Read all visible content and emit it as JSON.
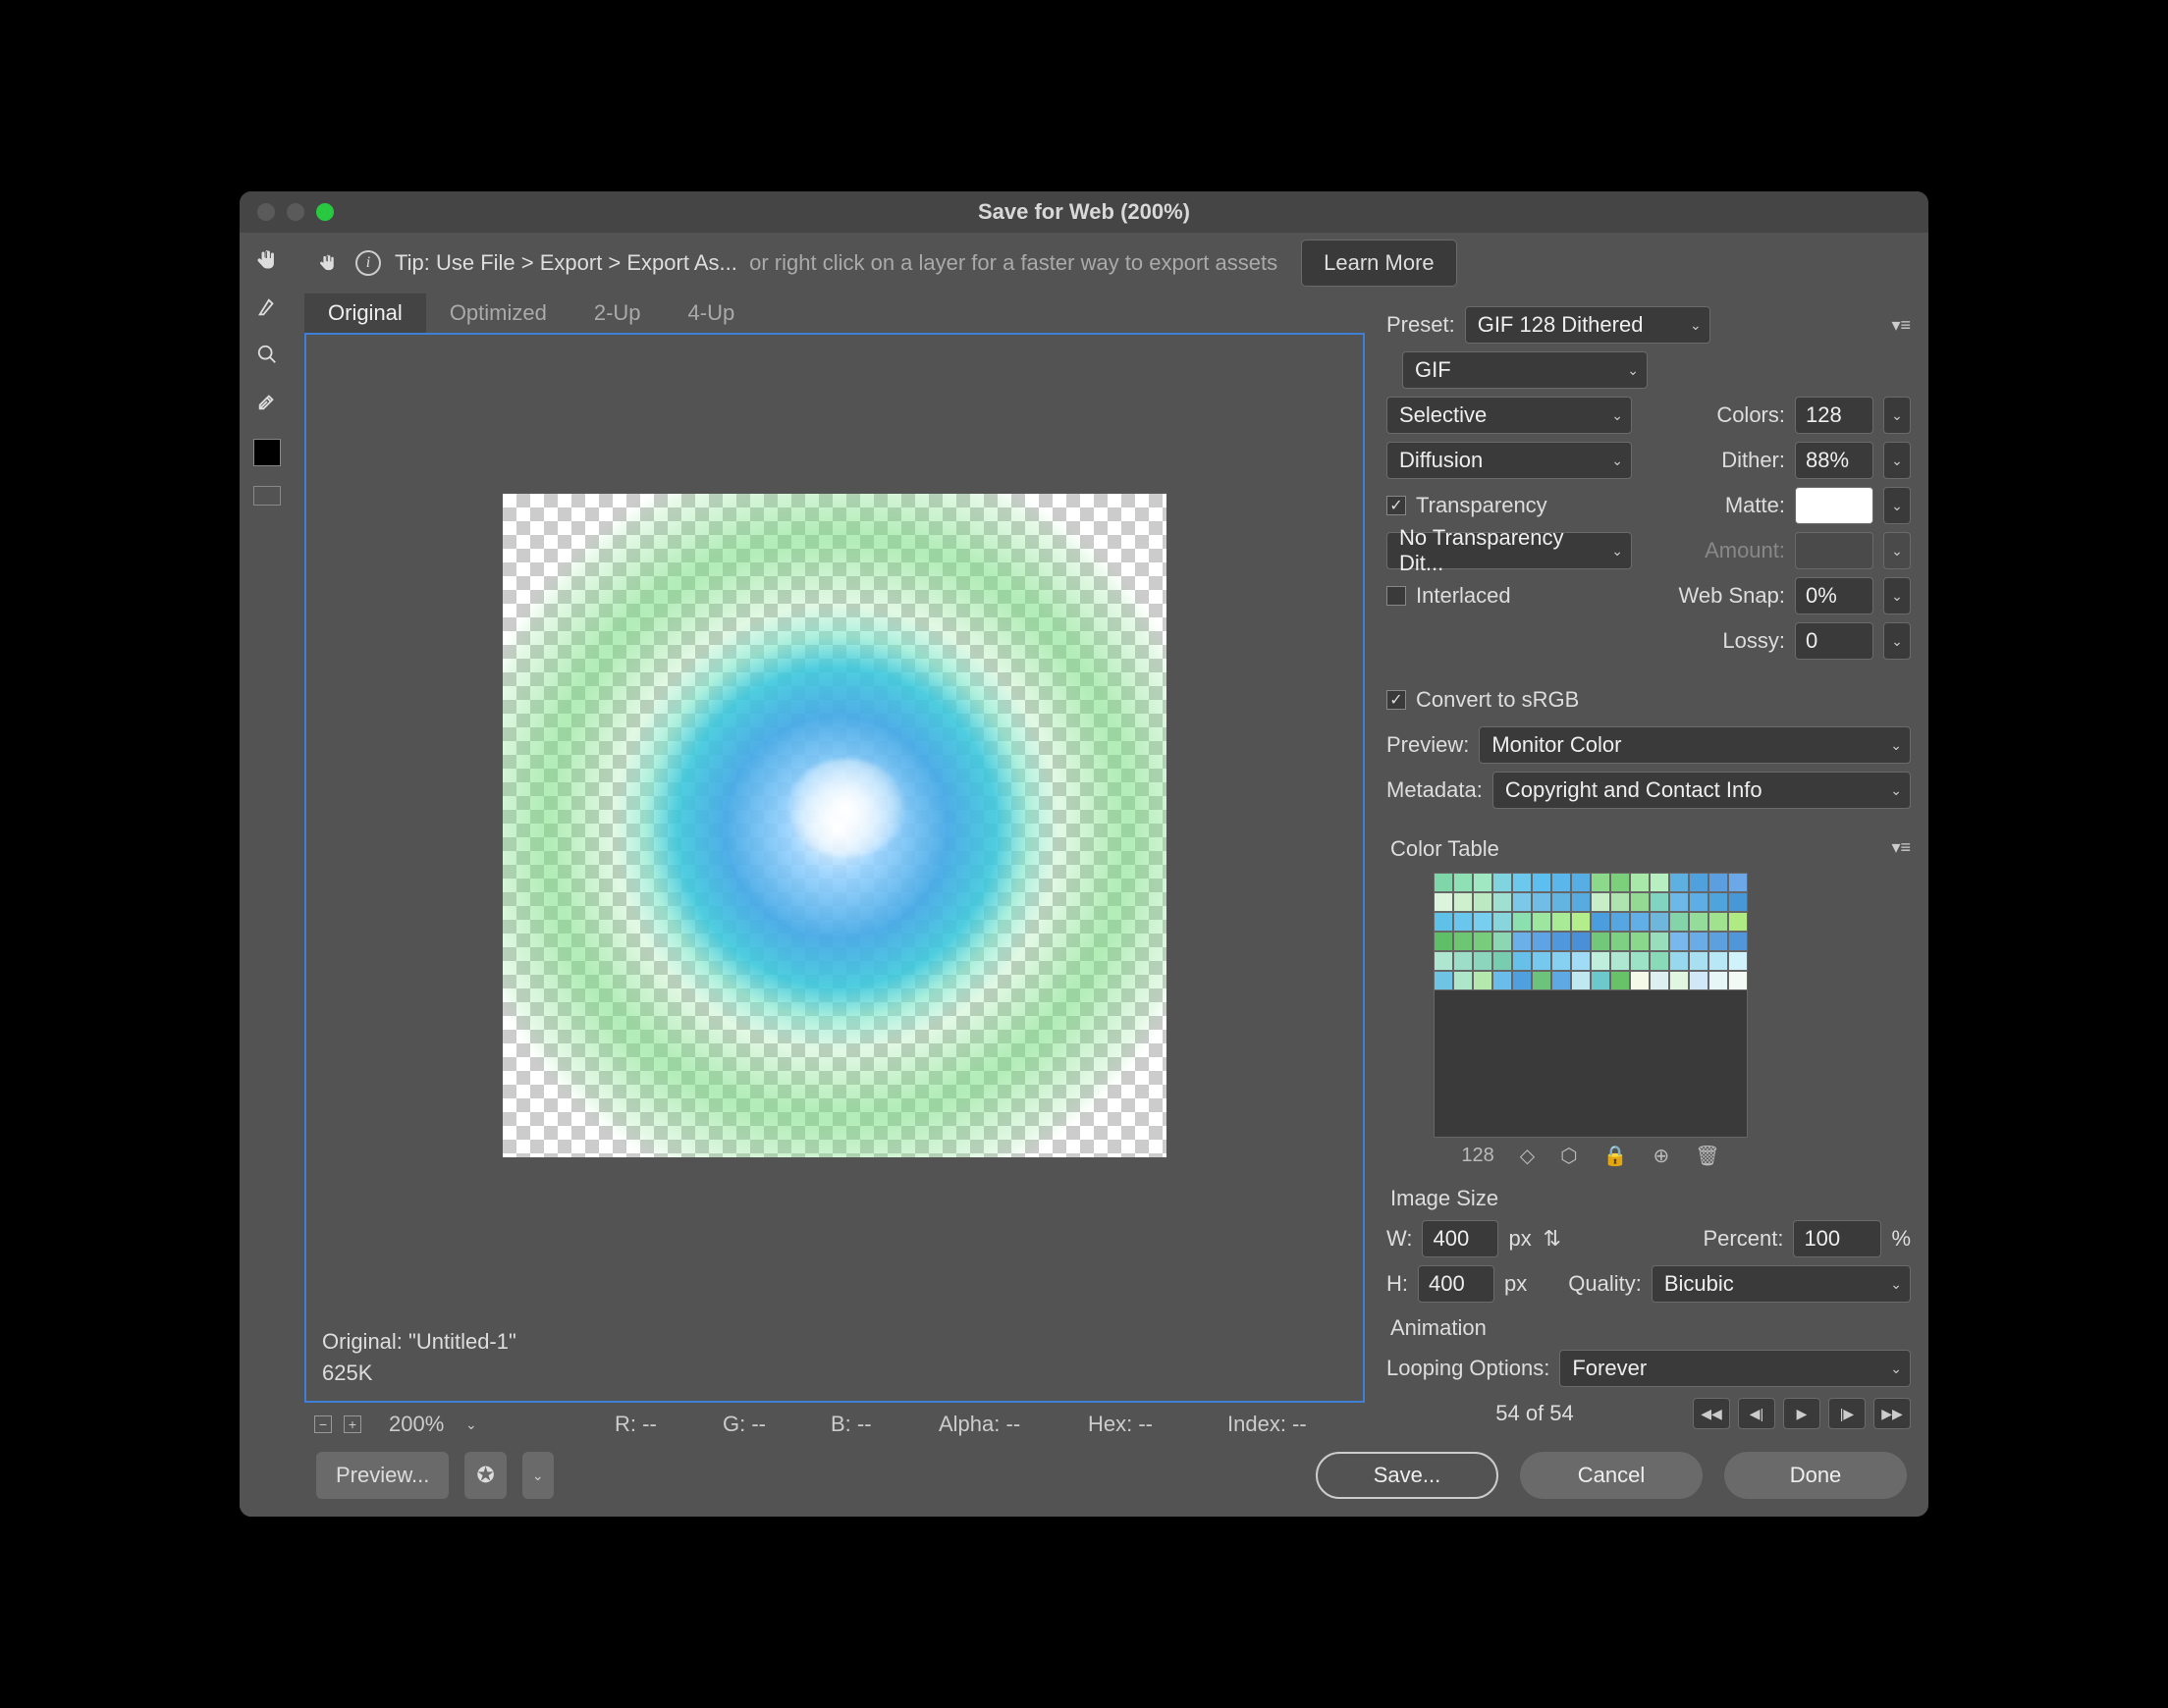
{
  "title": "Save for Web (200%)",
  "tip": {
    "prefix": "Tip: Use File > Export > Export As...",
    "suffix": "or right click on a layer for a faster way to export assets",
    "learn_more": "Learn More"
  },
  "tabs": {
    "original": "Original",
    "optimized": "Optimized",
    "two_up": "2-Up",
    "four_up": "4-Up"
  },
  "canvas": {
    "info_line1": "Original: \"Untitled-1\"",
    "info_line2": "625K"
  },
  "status": {
    "zoom": "200%",
    "r": "R: --",
    "g": "G: --",
    "b": "B: --",
    "alpha": "Alpha: --",
    "hex": "Hex: --",
    "index": "Index: --"
  },
  "footer": {
    "preview": "Preview...",
    "save": "Save...",
    "cancel": "Cancel",
    "done": "Done"
  },
  "preset": {
    "label": "Preset:",
    "value": "GIF 128 Dithered"
  },
  "format": "GIF",
  "reduction": "Selective",
  "dither_method": "Diffusion",
  "transparency": {
    "label": "Transparency",
    "checked": true
  },
  "trans_dither": "No Transparency Dit...",
  "interlaced": {
    "label": "Interlaced",
    "checked": false
  },
  "colors": {
    "label": "Colors:",
    "value": "128"
  },
  "dither": {
    "label": "Dither:",
    "value": "88%"
  },
  "matte": {
    "label": "Matte:"
  },
  "amount": {
    "label": "Amount:"
  },
  "web_snap": {
    "label": "Web Snap:",
    "value": "0%"
  },
  "lossy": {
    "label": "Lossy:",
    "value": "0"
  },
  "srgb": {
    "label": "Convert to sRGB",
    "checked": true
  },
  "preview": {
    "label": "Preview:",
    "value": "Monitor Color"
  },
  "metadata": {
    "label": "Metadata:",
    "value": "Copyright and Contact Info"
  },
  "color_table": {
    "label": "Color Table",
    "count": "128"
  },
  "image_size": {
    "label": "Image Size",
    "w_label": "W:",
    "w": "400",
    "h_label": "H:",
    "h": "400",
    "px": "px",
    "percent_label": "Percent:",
    "percent": "100",
    "pct_sign": "%",
    "quality_label": "Quality:",
    "quality": "Bicubic"
  },
  "animation": {
    "label": "Animation",
    "looping_label": "Looping Options:",
    "looping": "Forever",
    "counter": "54 of 54"
  },
  "swatch_colors": [
    "#7fd6a8",
    "#8fe0b5",
    "#a0e8c2",
    "#7fd4e0",
    "#6cc8ec",
    "#5dbef0",
    "#5ab6eb",
    "#57aee4",
    "#8cd98c",
    "#7cd07c",
    "#a8e8a8",
    "#b8efc0",
    "#5db0e0",
    "#4fa0dc",
    "#5c9fe0",
    "#6ca8e8",
    "#ddf4dc",
    "#cff0cc",
    "#bce8c2",
    "#a0e0d0",
    "#7cc8e8",
    "#70bde8",
    "#64b4e2",
    "#58abde",
    "#c8eec8",
    "#aee4ae",
    "#94da94",
    "#80d4c0",
    "#6cb8e8",
    "#5caee4",
    "#50a4de",
    "#4898d8",
    "#5fc0e8",
    "#6ac6ec",
    "#78ceee",
    "#88d6dc",
    "#8ce0b0",
    "#9ce6a0",
    "#a8ea96",
    "#b4ee8c",
    "#4a9ede",
    "#56a6e2",
    "#62aee6",
    "#6eb6dc",
    "#84d4aa",
    "#94dc9a",
    "#a0e28e",
    "#b0ea82",
    "#5fbf68",
    "#6cc672",
    "#78cd7c",
    "#8cd6b4",
    "#6cb0ea",
    "#5ea4e4",
    "#5098de",
    "#4a90d6",
    "#72c878",
    "#7ed082",
    "#8ad88c",
    "#98debc",
    "#78b8ec",
    "#6aace6",
    "#5ca0e0",
    "#5296da",
    "#aee6d2",
    "#9cdec8",
    "#8cd6be",
    "#78ccb0",
    "#66c0ea",
    "#76c8ee",
    "#86d0f2",
    "#a0dcf6",
    "#c0eedc",
    "#aee8d2",
    "#9ce2c6",
    "#88dab8",
    "#98d8ee",
    "#a8e0f2",
    "#b8e8f6",
    "#d0f2fa",
    "#6fc4e4",
    "#aee6ca",
    "#b4e8ac",
    "#6abceb",
    "#4ea0de",
    "#6cc47c",
    "#5ea8e4",
    "#bfe8f0",
    "#6cc8ca",
    "#68c268",
    "#f4f9e8",
    "#deeff0",
    "#e0f6e0",
    "#d0e8f8",
    "#e6f6f6",
    "#f3f9f3"
  ]
}
